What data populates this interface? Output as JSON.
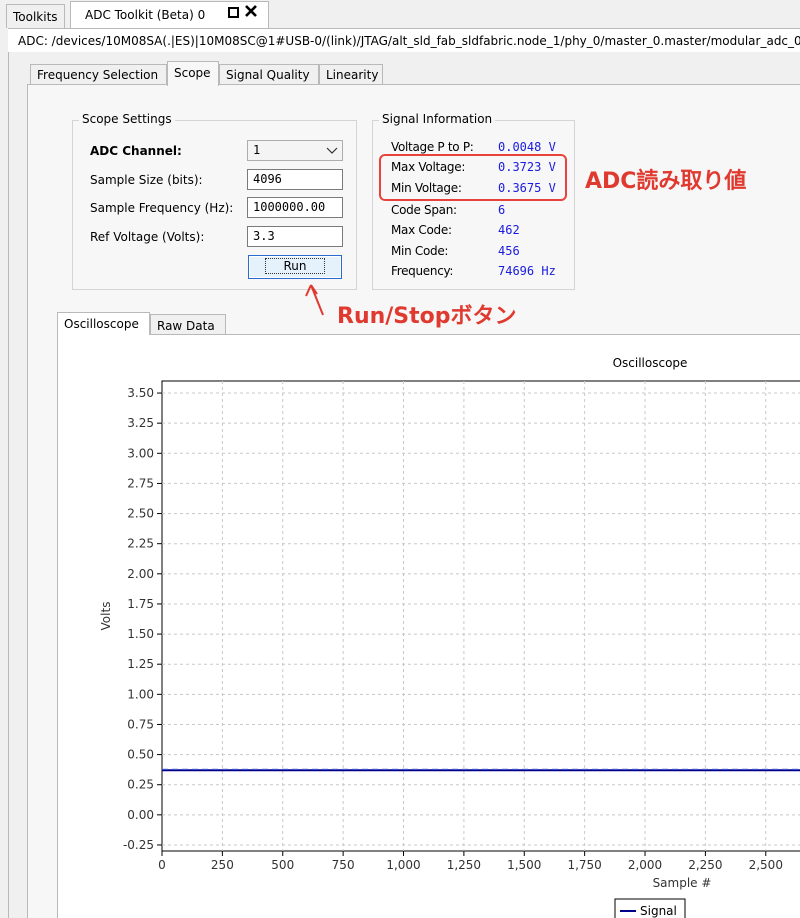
{
  "window_tabs": [
    {
      "label": "Toolkits"
    },
    {
      "label": "ADC Toolkit (Beta) 0"
    }
  ],
  "window_controls": {
    "maximize_icon": "square-icon",
    "close_icon": "close-x-icon"
  },
  "path_bar": "ADC: /devices/10M08SA(.|ES)|10M08SC@1#USB-0/(link)/JTAG/alt_sld_fab_sldfabric.node_1/phy_0/master_0.master/modular_adc_0",
  "sub_tabs": [
    {
      "label": "Frequency Selection"
    },
    {
      "label": "Scope"
    },
    {
      "label": "Signal Quality"
    },
    {
      "label": "Linearity"
    }
  ],
  "scope_settings": {
    "title": "Scope Settings",
    "adc_channel_label": "ADC Channel:",
    "adc_channel_value": "1",
    "sample_size_label": "Sample Size (bits):",
    "sample_size_value": "4096",
    "sample_freq_label": "Sample Frequency (Hz):",
    "sample_freq_value": "1000000.00",
    "ref_voltage_label": "Ref Voltage (Volts):",
    "ref_voltage_value": "3.3",
    "run_label": "Run"
  },
  "signal_info": {
    "title": "Signal Information",
    "rows": [
      {
        "label": "Voltage P to P:",
        "value": "0.0048 V"
      },
      {
        "label": "Max Voltage:",
        "value": "0.3723 V"
      },
      {
        "label": "Min Voltage:",
        "value": "0.3675 V"
      },
      {
        "label": "Code Span:",
        "value": "6"
      },
      {
        "label": "Max Code:",
        "value": "462"
      },
      {
        "label": "Min Code:",
        "value": "456"
      },
      {
        "label": "Frequency:",
        "value": "74696 Hz"
      }
    ]
  },
  "annotations": {
    "adc_reading": "ADC読み取り値",
    "run_stop": "Run/Stopボタン"
  },
  "annotation_color": "#e03a30",
  "chart_tabs": [
    {
      "label": "Oscilloscope"
    },
    {
      "label": "Raw Data"
    }
  ],
  "chart_data": {
    "type": "line",
    "title": "Oscilloscope",
    "xlabel": "Sample #",
    "ylabel": "Volts",
    "xlim": [
      0,
      2650
    ],
    "ylim": [
      -0.3,
      3.6
    ],
    "x_ticks": [
      0,
      250,
      500,
      750,
      1000,
      1250,
      1500,
      1750,
      2000,
      2250,
      2500
    ],
    "x_tick_labels": [
      "0",
      "250",
      "500",
      "750",
      "1,000",
      "1,250",
      "1,500",
      "1,750",
      "2,000",
      "2,250",
      "2,500"
    ],
    "y_ticks": [
      -0.25,
      0.0,
      0.25,
      0.5,
      0.75,
      1.0,
      1.25,
      1.5,
      1.75,
      2.0,
      2.25,
      2.5,
      2.75,
      3.0,
      3.25,
      3.5
    ],
    "y_tick_labels": [
      "-0.25",
      "0.00",
      "0.25",
      "0.50",
      "0.75",
      "1.00",
      "1.25",
      "1.50",
      "1.75",
      "2.00",
      "2.25",
      "2.50",
      "2.75",
      "3.00",
      "3.25",
      "3.50"
    ],
    "grid": true,
    "series": [
      {
        "name": "Signal",
        "color": "#00008b",
        "x": [
          0,
          2650
        ],
        "values": [
          0.37,
          0.37
        ]
      }
    ],
    "legend_label": "Signal"
  }
}
